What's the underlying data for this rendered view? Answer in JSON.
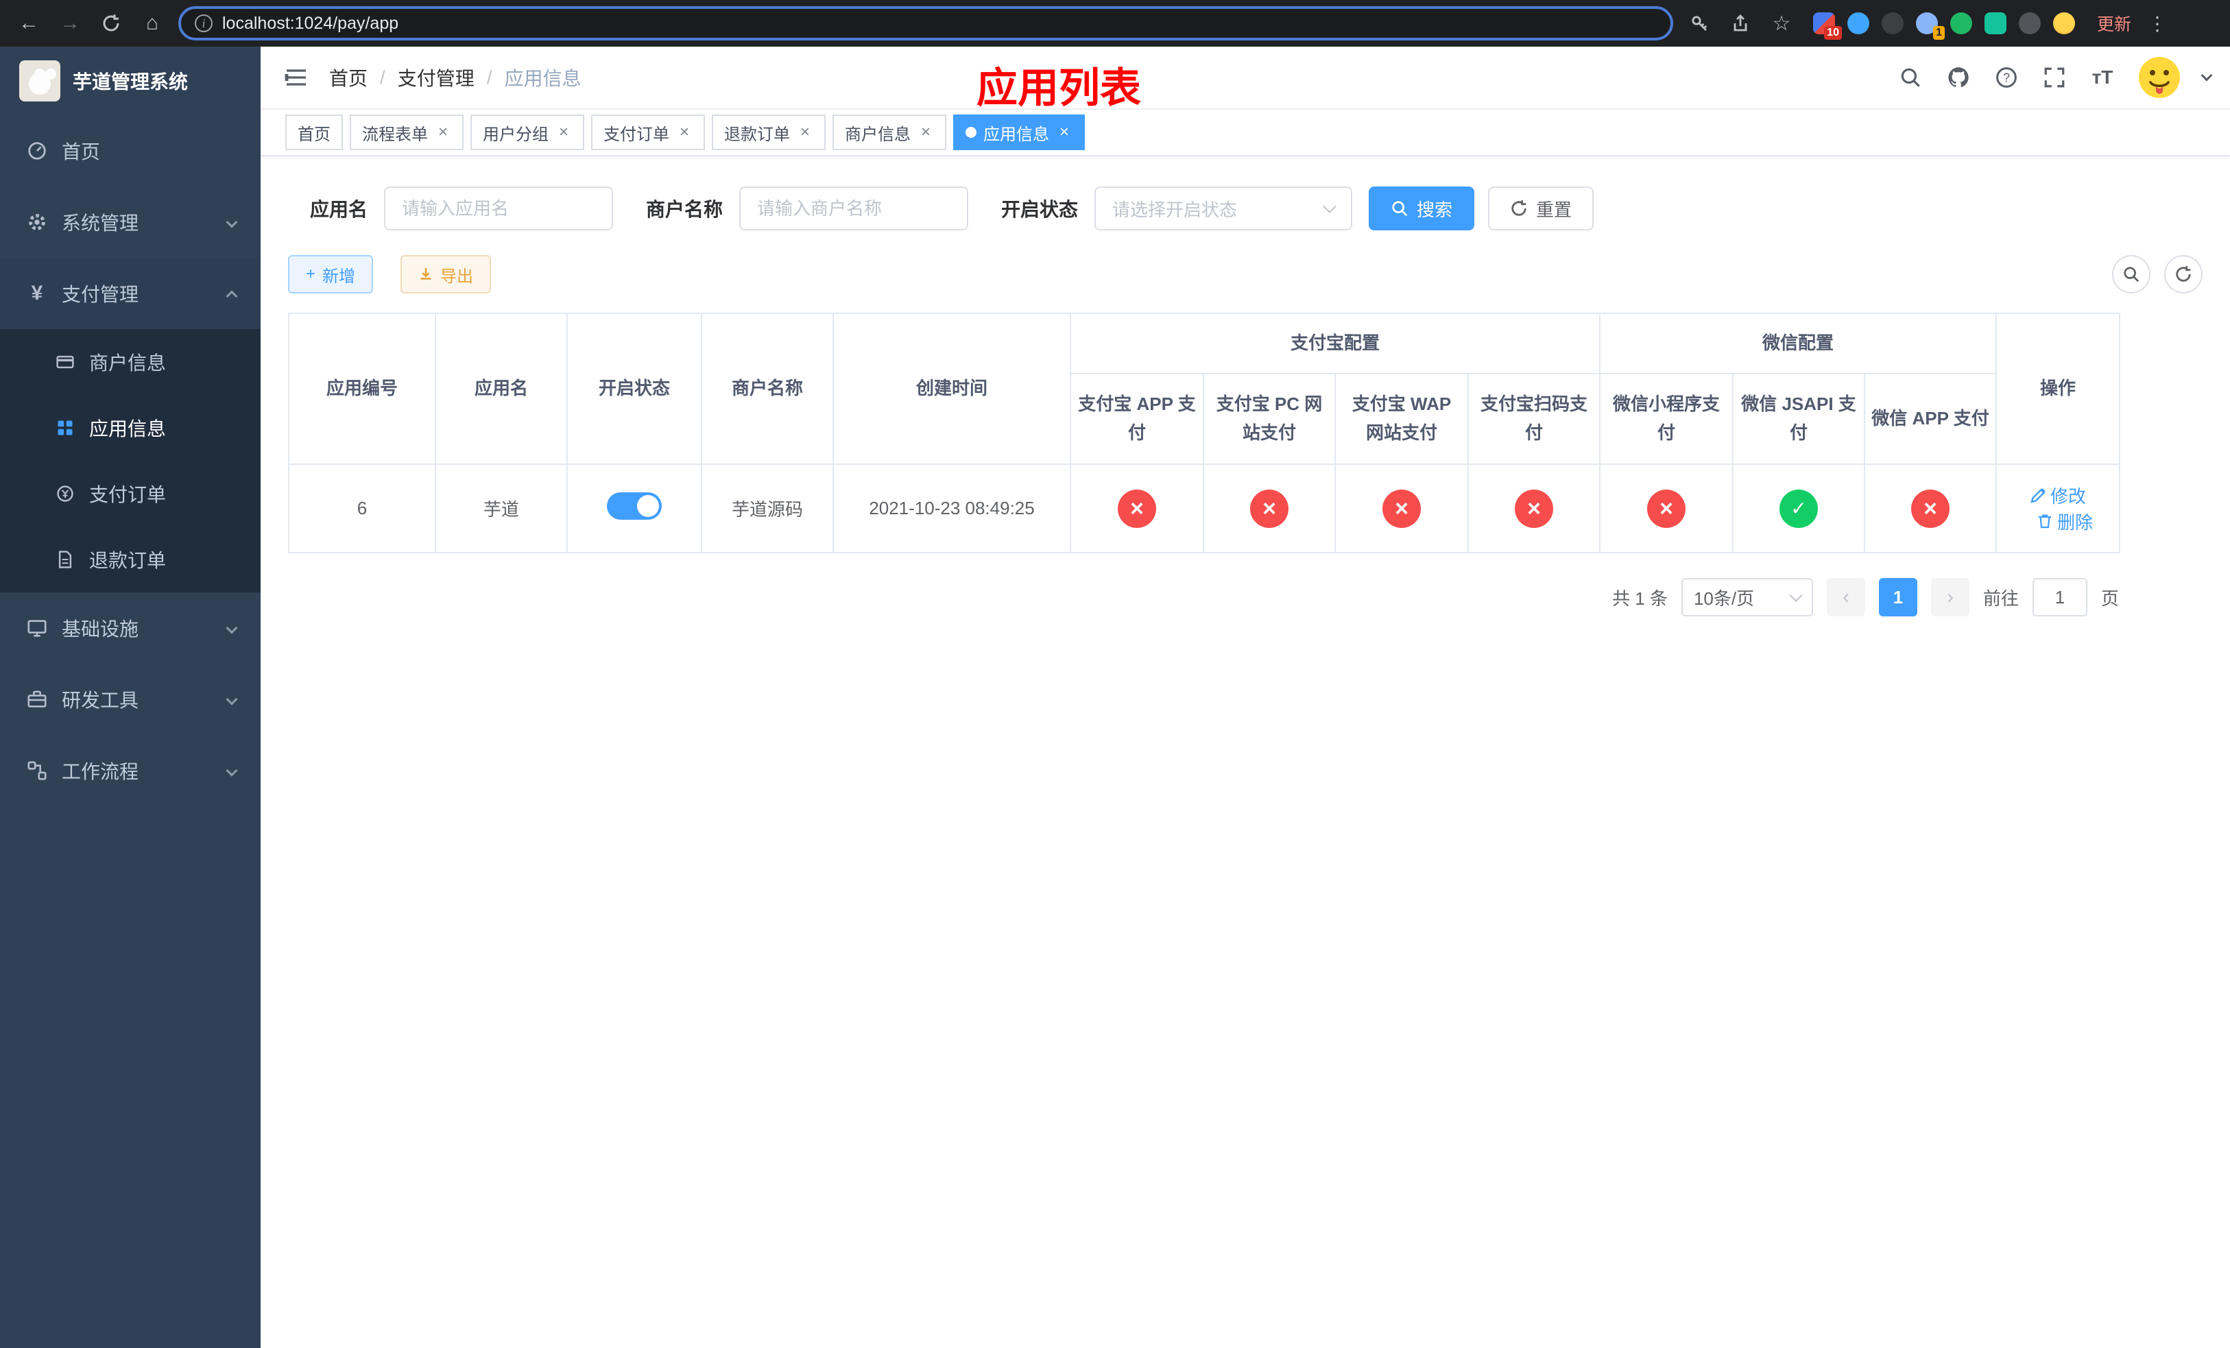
{
  "browser": {
    "url": "localhost:1024/pay/app",
    "update_label": "更新",
    "ext_badge_blue_grid": "10",
    "ext_badge_green": "1"
  },
  "sidebar": {
    "logo_title": "芋道管理系统",
    "items": [
      {
        "label": "首页"
      },
      {
        "label": "系统管理"
      },
      {
        "label": "支付管理"
      },
      {
        "label": "基础设施"
      },
      {
        "label": "研发工具"
      },
      {
        "label": "工作流程"
      }
    ],
    "payment_children": [
      {
        "label": "商户信息"
      },
      {
        "label": "应用信息"
      },
      {
        "label": "支付订单"
      },
      {
        "label": "退款订单"
      }
    ]
  },
  "header": {
    "breadcrumb": [
      {
        "label": "首页"
      },
      {
        "label": "支付管理"
      },
      {
        "label": "应用信息"
      }
    ],
    "separator": "/",
    "page_title": "应用列表"
  },
  "tabs": [
    {
      "label": "首页"
    },
    {
      "label": "流程表单"
    },
    {
      "label": "用户分组"
    },
    {
      "label": "支付订单"
    },
    {
      "label": "退款订单"
    },
    {
      "label": "商户信息"
    },
    {
      "label": "应用信息"
    }
  ],
  "filters": {
    "app_name": {
      "label": "应用名",
      "placeholder": "请输入应用名",
      "value": ""
    },
    "merchant_name": {
      "label": "商户名称",
      "placeholder": "请输入商户名称",
      "value": ""
    },
    "status": {
      "label": "开启状态",
      "placeholder": "请选择开启状态"
    },
    "search_label": "搜索",
    "reset_label": "重置"
  },
  "toolbar": {
    "add_label": "新增",
    "export_label": "导出"
  },
  "table": {
    "col_app_id": "应用编号",
    "col_app_name": "应用名",
    "col_status": "开启状态",
    "col_merchant": "商户名称",
    "col_created": "创建时间",
    "group_alipay": "支付宝配置",
    "group_wechat": "微信配置",
    "alipay_cols": [
      "支付宝 APP 支付",
      "支付宝 PC 网站支付",
      "支付宝 WAP 网站支付",
      "支付宝扫码支付"
    ],
    "wechat_cols": [
      "微信小程序支付",
      "微信 JSAPI 支付",
      "微信 APP 支付"
    ],
    "col_ops": "操作",
    "row": {
      "id": "6",
      "name": "芋道",
      "enabled": true,
      "merchant": "芋道源码",
      "created": "2021-10-23 08:49:25",
      "statuses": [
        "no",
        "no",
        "no",
        "no",
        "no",
        "yes",
        "no"
      ],
      "edit_label": "修改",
      "delete_label": "删除"
    }
  },
  "pagination": {
    "total": "共 1 条",
    "page_size": "10条/页",
    "page": "1",
    "goto_label": "前往",
    "goto_value": "1",
    "goto_unit": "页"
  },
  "colors": {
    "accent": "#409EFF",
    "success": "#13ce66",
    "danger": "#f64c4c",
    "title_red": "#ff0000",
    "sidebar_bg": "#304156",
    "submenu_bg": "#1f2d3d"
  }
}
